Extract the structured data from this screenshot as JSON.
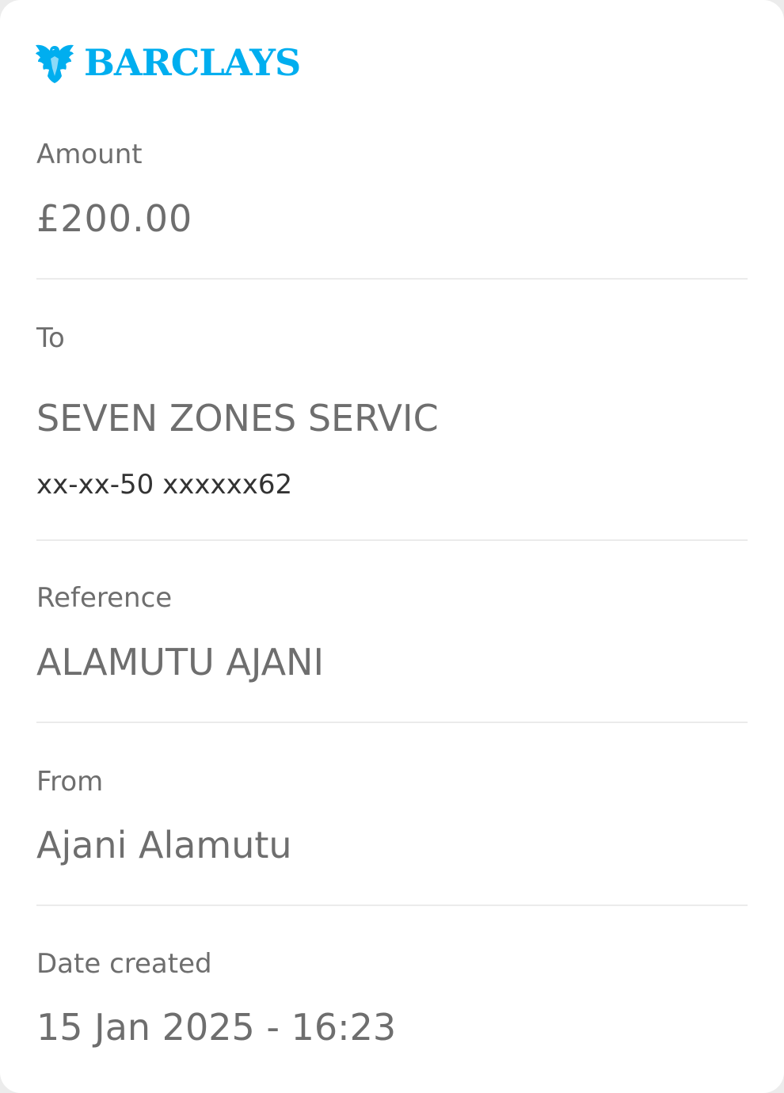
{
  "brand": {
    "name": "BARCLAYS",
    "logo_icon": "eagle-icon",
    "color": "#00aeef"
  },
  "colors": {
    "text": "#6e6e6e",
    "subtext": "#333333",
    "divider": "#ebebeb"
  },
  "details": {
    "amount": {
      "label": "Amount",
      "value": "£200.00"
    },
    "to": {
      "label": "To",
      "value": "SEVEN ZONES SERVIC",
      "account": "xx-xx-50 xxxxxx62"
    },
    "reference": {
      "label": "Reference",
      "value": "ALAMUTU AJANI"
    },
    "from": {
      "label": "From",
      "value": "Ajani Alamutu"
    },
    "date_created": {
      "label": "Date created",
      "value": "15 Jan 2025 - 16:23"
    }
  }
}
